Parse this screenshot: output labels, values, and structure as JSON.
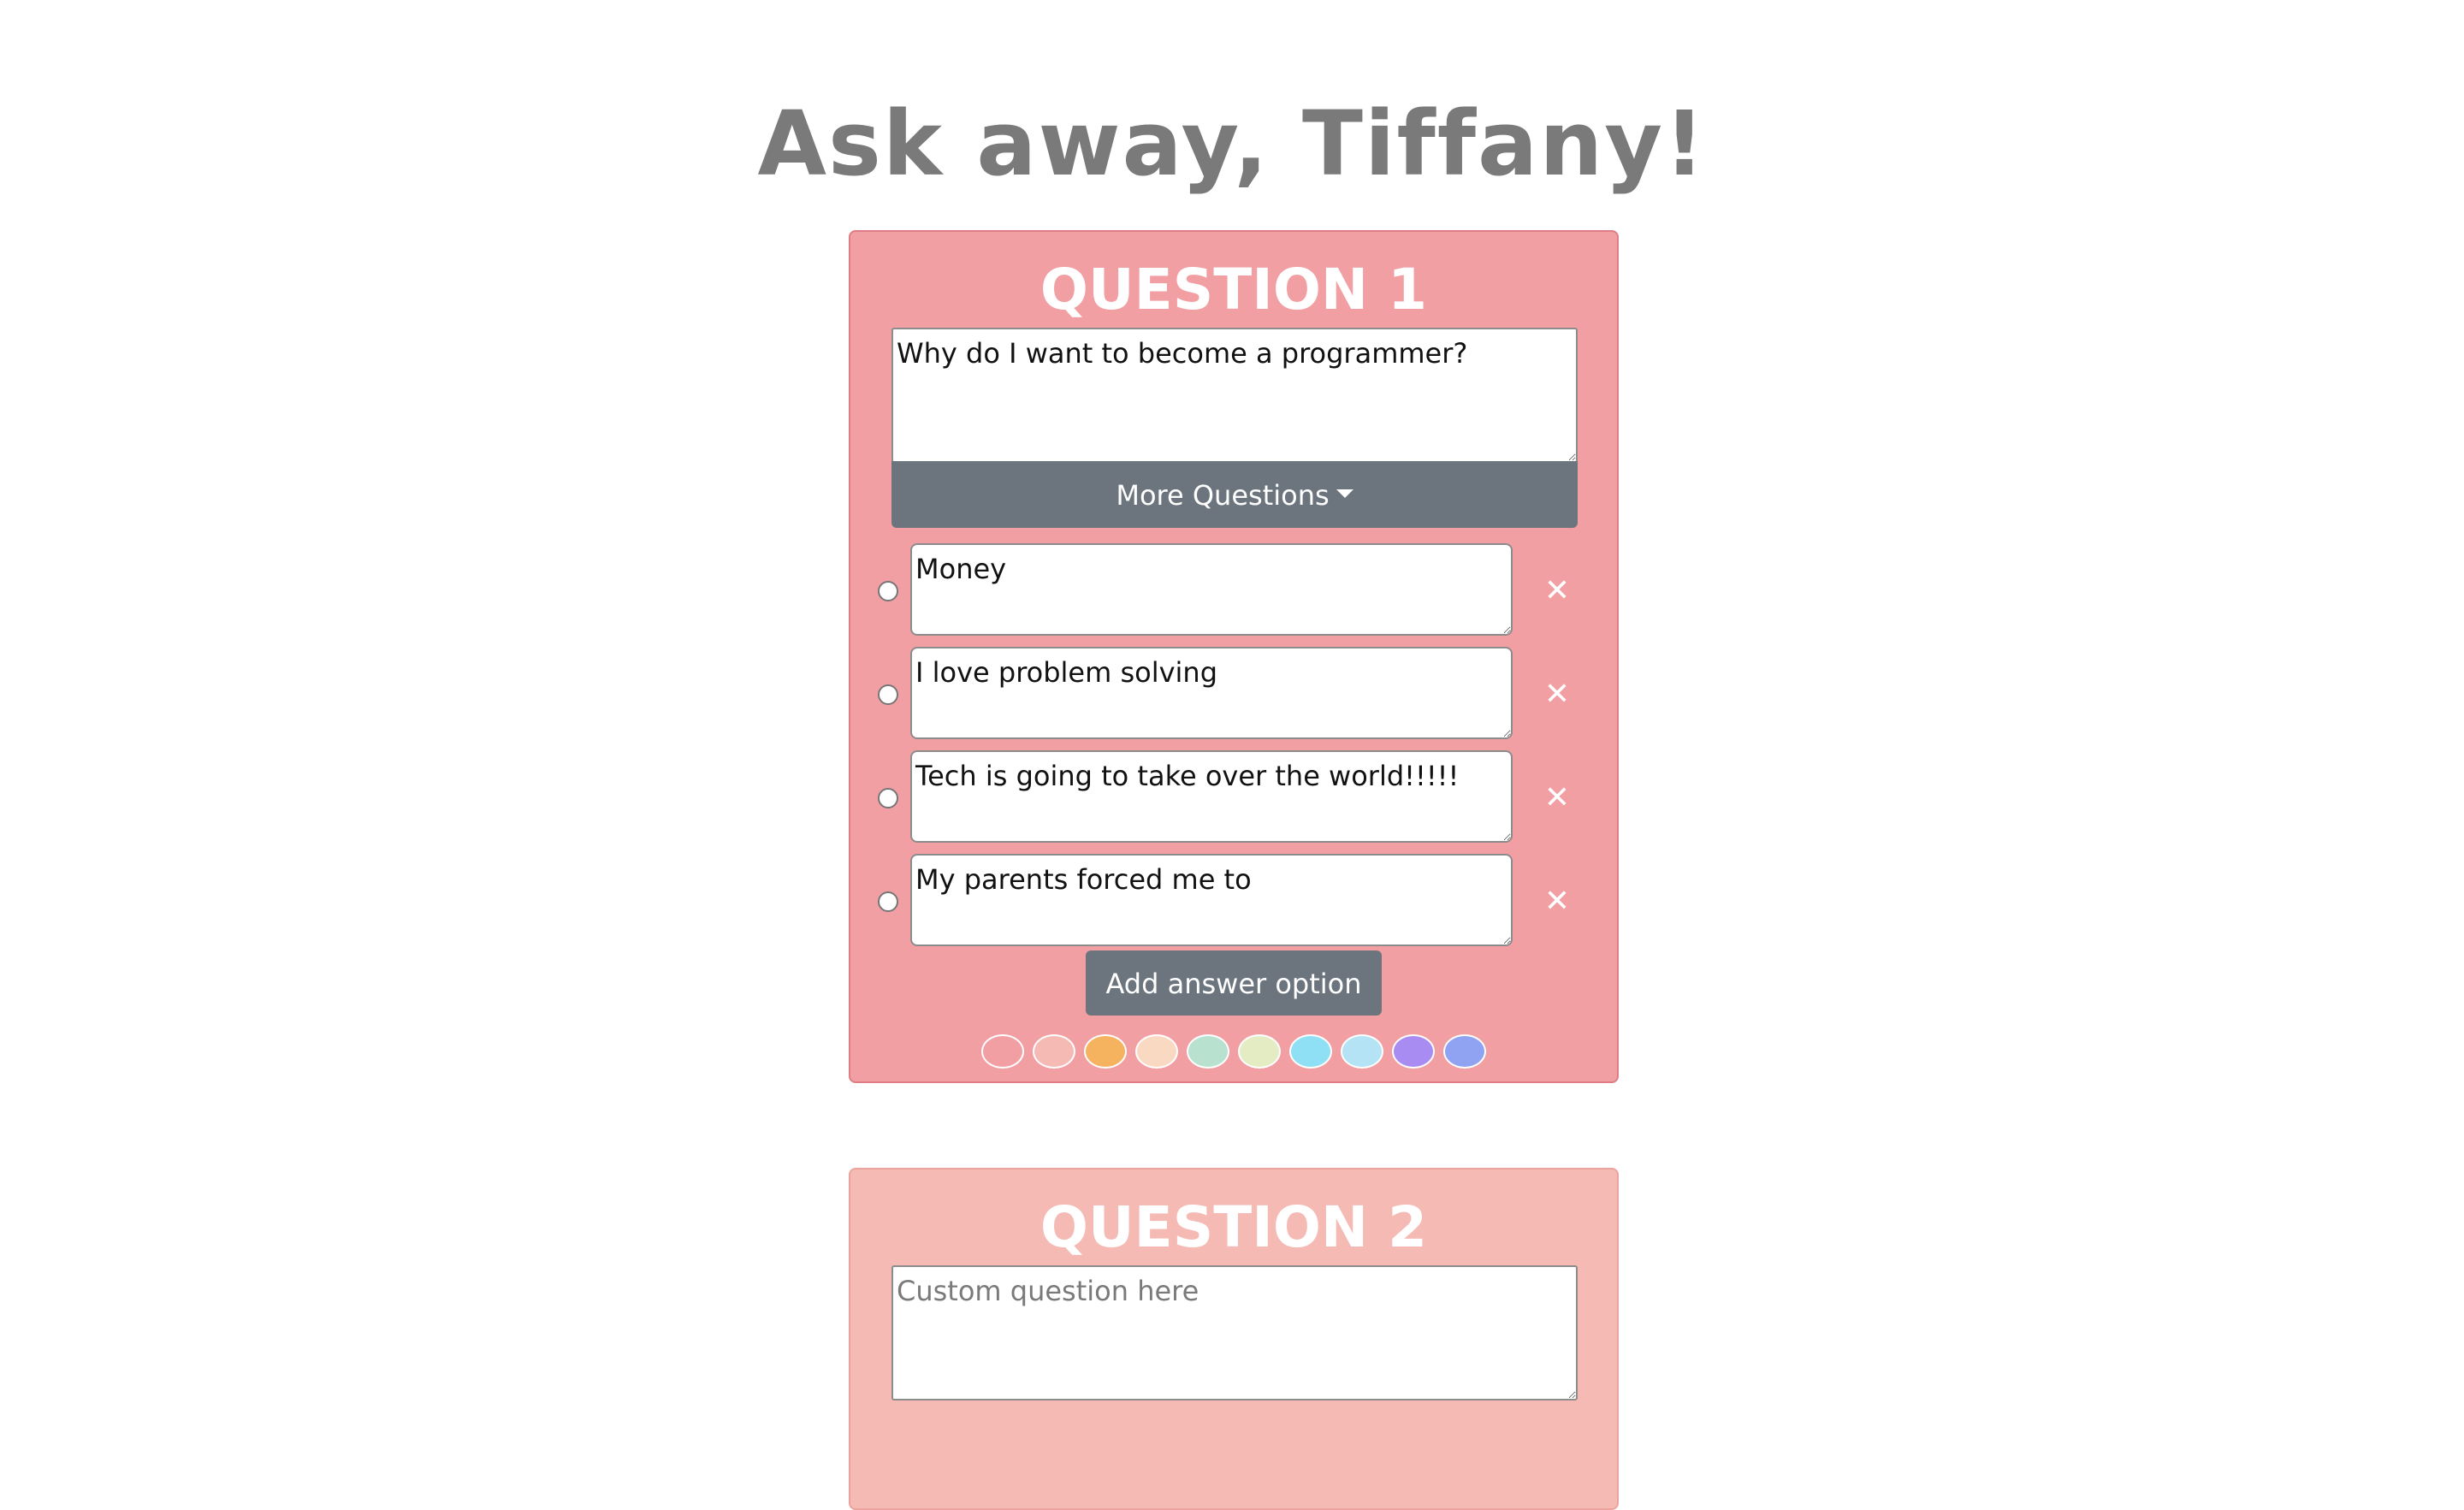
{
  "header": {
    "title": "Ask away, Tiffany!"
  },
  "questions": [
    {
      "heading": "QUESTION 1",
      "question_value": "Why do I want to become a programmer?",
      "more_label": "More Questions",
      "answers": [
        {
          "value": "Money",
          "delete_label": "✕"
        },
        {
          "value": "I love problem solving",
          "delete_label": "✕"
        },
        {
          "value": "Tech is going to take over the world!!!!!",
          "delete_label": "✕"
        },
        {
          "value": "My parents forced me to",
          "delete_label": "✕"
        }
      ],
      "add_option_label": "Add answer option",
      "card_color": "#f29fa4",
      "swatches": [
        "#f29fa4",
        "#f5bab4",
        "#f5b25f",
        "#f9d9c1",
        "#b8e2cf",
        "#e4ecc4",
        "#8fe0f4",
        "#b3e3f5",
        "#a98cf2",
        "#8fa3f2"
      ]
    },
    {
      "heading": "QUESTION 2",
      "question_placeholder": "Custom question here",
      "card_color": "#f5bab4"
    }
  ]
}
